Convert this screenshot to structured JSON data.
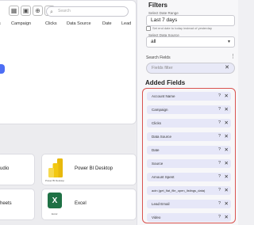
{
  "toolbar": {
    "search_placeholder": "Search"
  },
  "table": {
    "columns": [
      "Campaign",
      "Clicks",
      "Data Source",
      "Date",
      "Lead"
    ]
  },
  "sources": [
    {
      "label": "udio"
    },
    {
      "label": "Power BI Desktop",
      "sub": "Power BI Desktop"
    },
    {
      "label": "heets"
    },
    {
      "label": "Excel",
      "sub": "Excel"
    }
  ],
  "filters": {
    "title": "Filters",
    "date_range_label": "Select Date Range",
    "date_range_value": "Last 7 days",
    "yesterday_note": "Set end date to today instead of yesterday",
    "data_source_label": "Select Data Source",
    "data_source_value": "all",
    "search_fields_label": "Search Fields",
    "fields_filter_placeholder": "Fields filter"
  },
  "added_fields": {
    "title": "Added Fields",
    "items": [
      "Account Name",
      "Campaign",
      "Clicks",
      "Data Source",
      "Date",
      "Source",
      "Amount Spent",
      "actn (get_flat_file_open_listings_data)",
      "Lead Email",
      "Video"
    ]
  },
  "colors": {
    "accent_blue": "#4d6ef4",
    "chip_bg": "#e6e7f8",
    "highlight_red": "#d9534f",
    "excel_green": "#1f7145",
    "powerbi_yellow": "#f2c811"
  },
  "icons": [
    "grid-icon",
    "save-icon",
    "add-icon",
    "menu-icon",
    "search-icon",
    "chevron-down-icon",
    "more-icon",
    "close-icon",
    "help-icon"
  ]
}
